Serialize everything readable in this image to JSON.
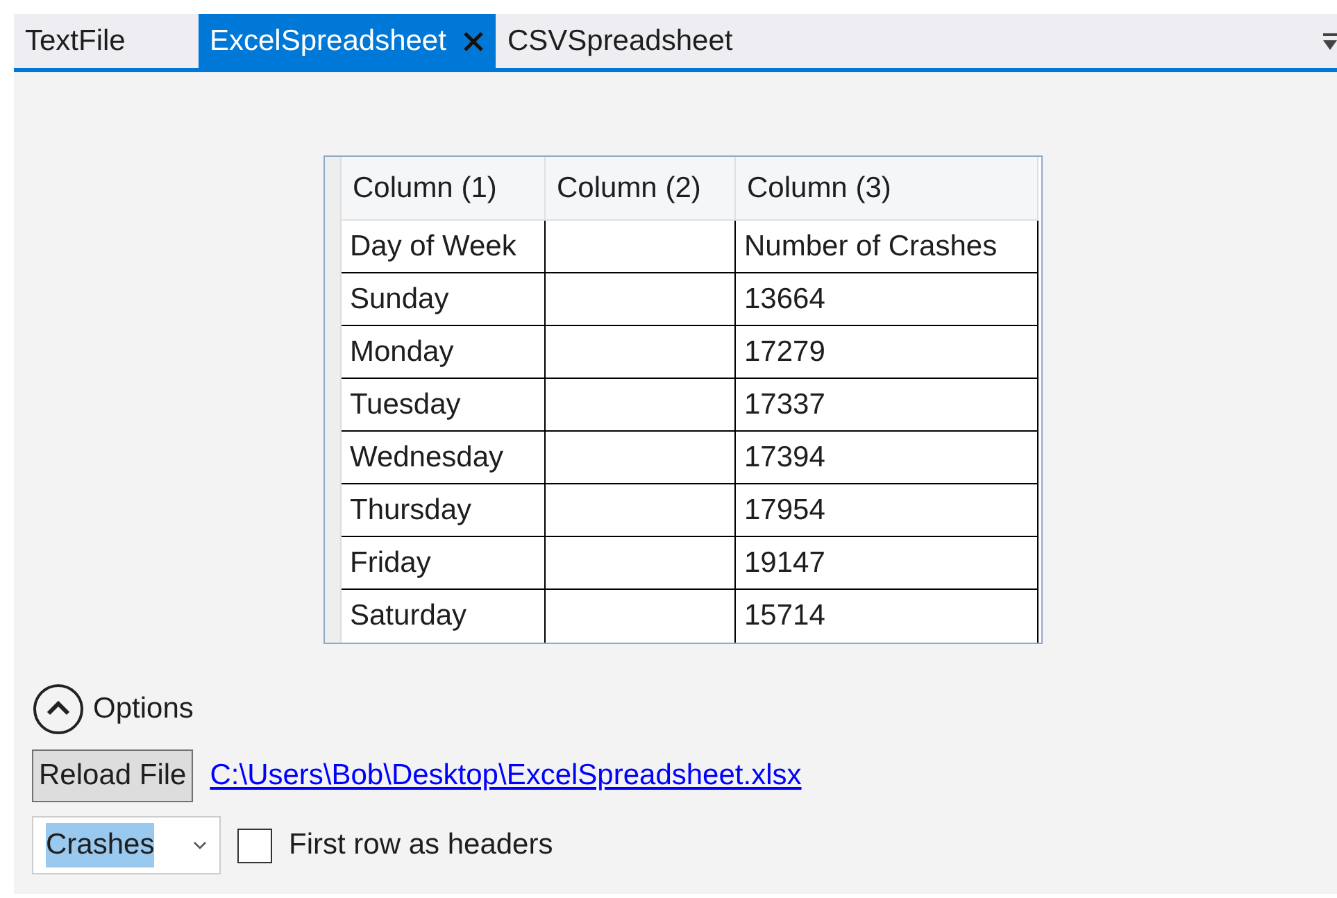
{
  "tabs": [
    {
      "label": "TextFile",
      "selected": false
    },
    {
      "label": "ExcelSpreadsheet",
      "selected": true
    },
    {
      "label": "CSVSpreadsheet",
      "selected": false
    }
  ],
  "table": {
    "columns": [
      "Column (1)",
      "Column (2)",
      "Column (3)"
    ],
    "rows": [
      [
        "Day of Week",
        "",
        "Number of Crashes"
      ],
      [
        "Sunday",
        "",
        "13664"
      ],
      [
        "Monday",
        "",
        "17279"
      ],
      [
        "Tuesday",
        "",
        "17337"
      ],
      [
        "Wednesday",
        "",
        "17394"
      ],
      [
        "Thursday",
        "",
        "17954"
      ],
      [
        "Friday",
        "",
        "19147"
      ],
      [
        "Saturday",
        "",
        "15714"
      ]
    ]
  },
  "options": {
    "label": "Options",
    "expanded": true
  },
  "reload_button": "Reload File",
  "file_link": "C:\\Users\\Bob\\Desktop\\ExcelSpreadsheet.xlsx",
  "sheet_select": {
    "value": "Crashes"
  },
  "first_row_headers": {
    "label": "First row as headers",
    "checked": false
  }
}
